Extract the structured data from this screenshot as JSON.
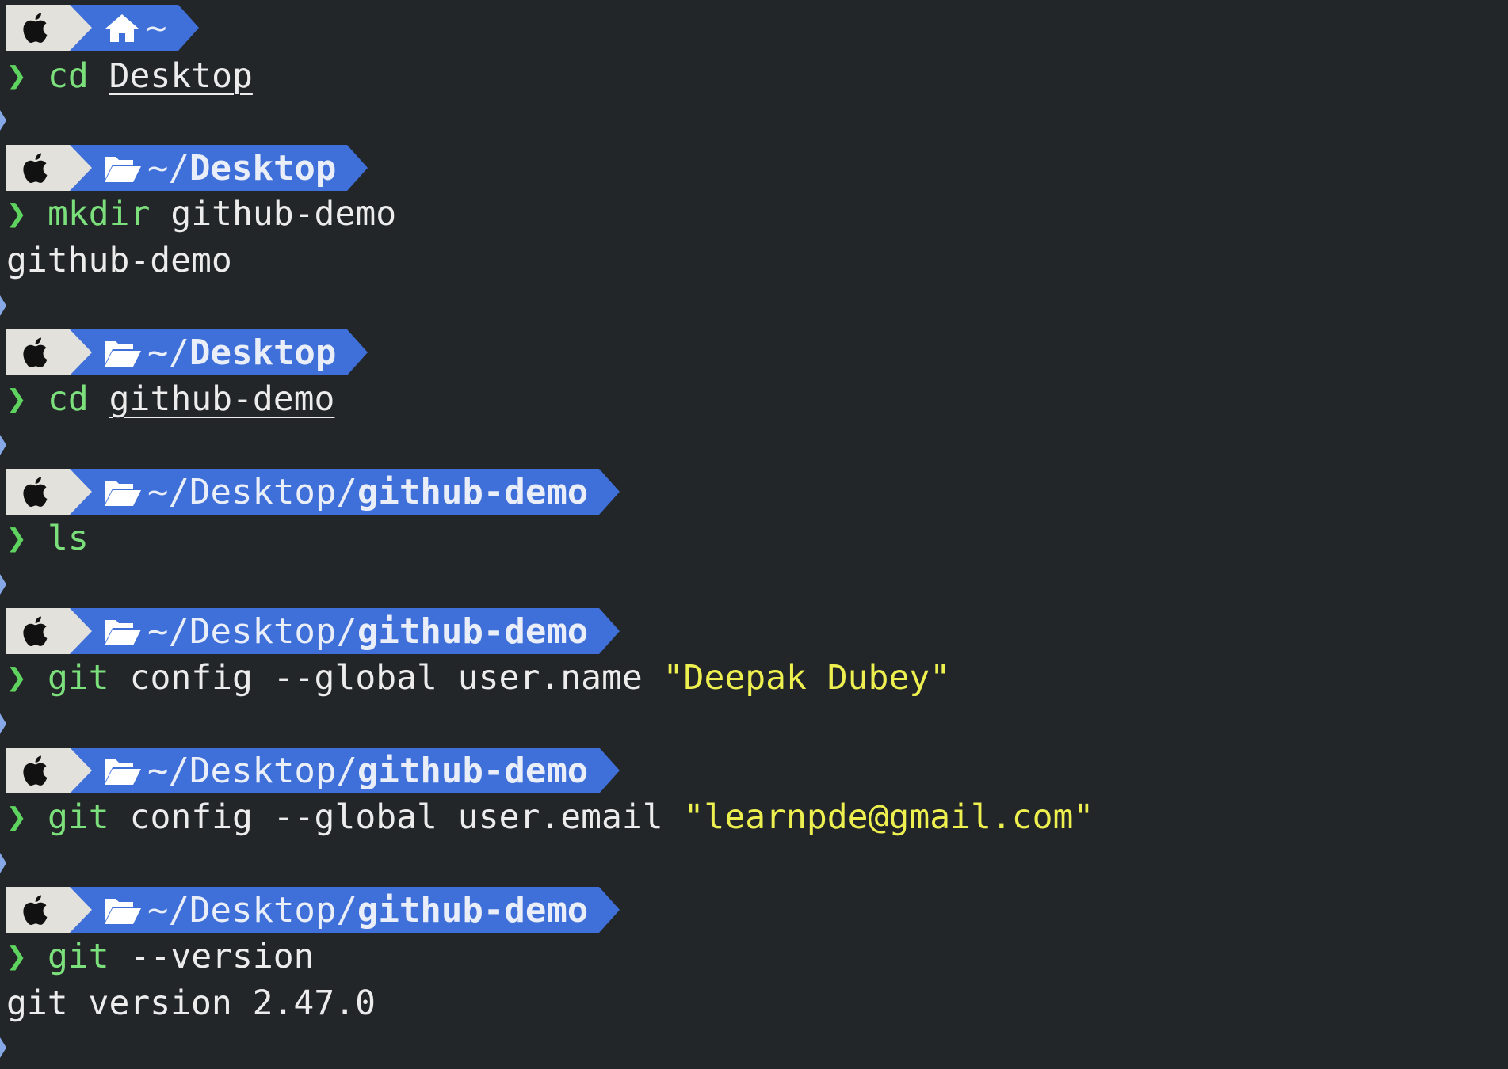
{
  "colors": {
    "background": "#232629",
    "os_segment": "#e3e1dc",
    "path_segment": "#3f6fd8",
    "prompt_chevron": "#5fd35f",
    "command": "#7be07b",
    "string": "#eef04f",
    "text": "#ececec"
  },
  "prompt_char": "❯",
  "entries": [
    {
      "path_icon": "home-icon",
      "path_plain": "~",
      "path_bold": "",
      "cmd": "cd",
      "args": "Desktop",
      "args_underlined": true,
      "string": "",
      "output": ""
    },
    {
      "path_icon": "folder-open-icon",
      "path_plain": "~/",
      "path_bold": "Desktop",
      "cmd": "mkdir",
      "args": "github-demo",
      "args_underlined": false,
      "string": "",
      "output": "github-demo"
    },
    {
      "path_icon": "folder-open-icon",
      "path_plain": "~/",
      "path_bold": "Desktop",
      "cmd": "cd",
      "args": "github-demo",
      "args_underlined": true,
      "string": "",
      "output": ""
    },
    {
      "path_icon": "folder-open-icon",
      "path_plain": "~/Desktop/",
      "path_bold": "github-demo",
      "cmd": "ls",
      "args": "",
      "args_underlined": false,
      "string": "",
      "output": ""
    },
    {
      "path_icon": "folder-open-icon",
      "path_plain": "~/Desktop/",
      "path_bold": "github-demo",
      "cmd": "git",
      "args": "config --global user.name",
      "args_underlined": false,
      "string": "\"Deepak Dubey\"",
      "output": ""
    },
    {
      "path_icon": "folder-open-icon",
      "path_plain": "~/Desktop/",
      "path_bold": "github-demo",
      "cmd": "git",
      "args": "config --global user.email",
      "args_underlined": false,
      "string": "\"learnpde@gmail.com\"",
      "output": ""
    },
    {
      "path_icon": "folder-open-icon",
      "path_plain": "~/Desktop/",
      "path_bold": "github-demo",
      "cmd": "git",
      "args": "--version",
      "args_underlined": false,
      "string": "",
      "output": "git version 2.47.0"
    }
  ]
}
